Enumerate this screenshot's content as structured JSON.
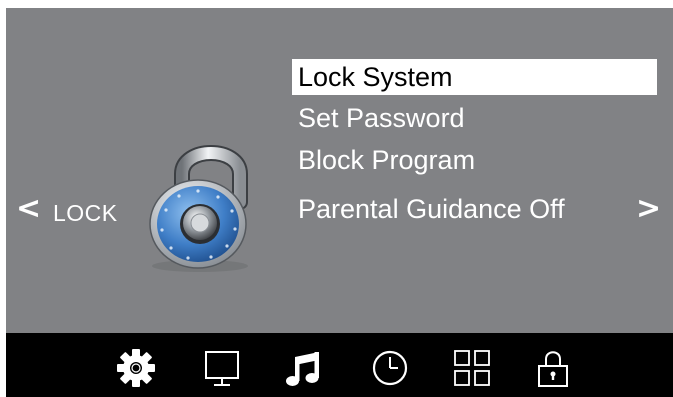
{
  "navigation": {
    "prev_glyph": "<",
    "next_glyph": ">"
  },
  "section": {
    "label": "LOCK",
    "icon": "combination-padlock-icon"
  },
  "menu": {
    "items": [
      {
        "label": "Lock System",
        "selected": true
      },
      {
        "label": "Set Password",
        "selected": false
      },
      {
        "label": "Block Program",
        "selected": false
      },
      {
        "label": "Parental Guidance Off",
        "selected": false
      }
    ]
  },
  "taskbar": {
    "icons": [
      "gear-icon",
      "monitor-icon",
      "music-note-icon",
      "clock-icon",
      "grid-icon",
      "lock-icon"
    ],
    "active": "gear-icon"
  },
  "colors": {
    "screen_bg": "#818285",
    "taskbar_bg": "#000000",
    "highlight": "#ffffff",
    "dial": "#3f7ec7"
  }
}
